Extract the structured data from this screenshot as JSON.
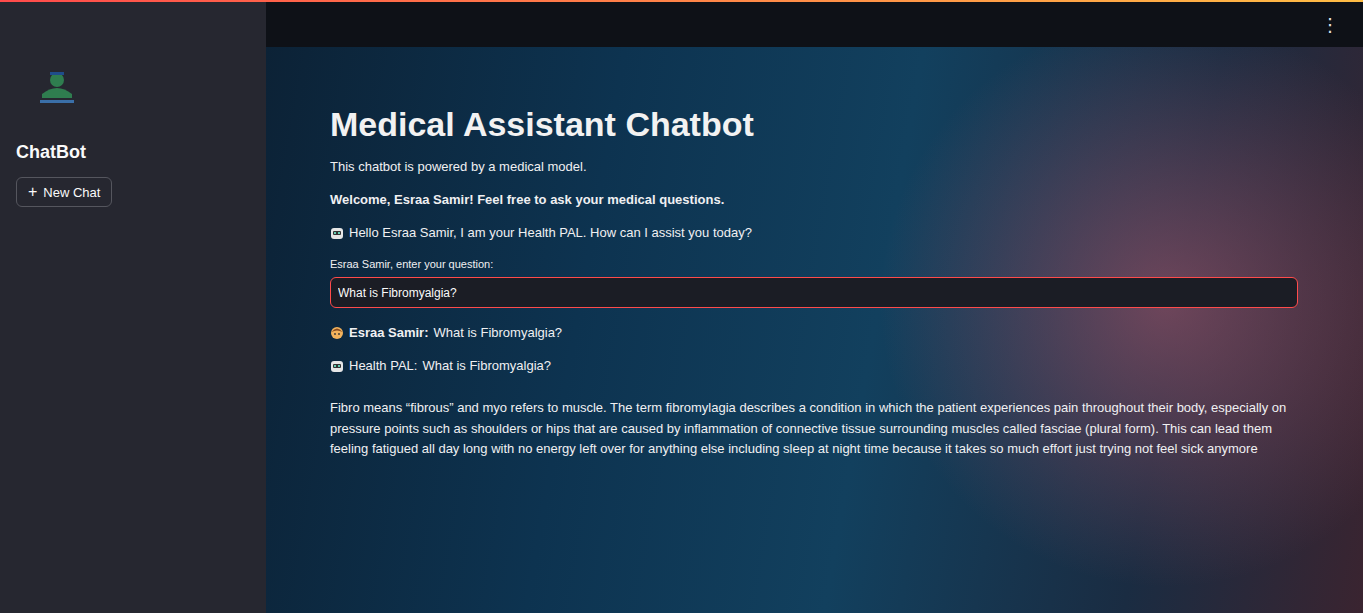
{
  "sidebar": {
    "title": "ChatBot",
    "new_chat_button": {
      "icon": "+",
      "label": "New Chat"
    }
  },
  "header": {
    "menu_icon": "⋮"
  },
  "main": {
    "title": "Medical Assistant Chatbot",
    "subtitle": "This chatbot is powered by a medical model.",
    "welcome": "Welcome, Esraa Samir! Feel free to ask your medical questions.",
    "greeting": "Hello Esraa Samir, I am your Health PAL. How can I assist you today?",
    "input": {
      "label": "Esraa Samir, enter your question:",
      "value": "What is Fibromyalgia?",
      "focused": true
    },
    "messages": [
      {
        "kind": "user",
        "speaker": "Esraa Samir:",
        "text": "What is Fibromyalgia?"
      },
      {
        "kind": "bot",
        "speaker": "Health PAL:",
        "text": "What is Fibromyalgia?"
      }
    ],
    "answer": "Fibro means “fibrous” and myo refers to muscle. The term fibromylagia describes a condition in which the patient experiences pain throughout their body, especially on pressure points such as shoulders or hips that are caused by inflammation of connective tissue surrounding muscles called fasciae (plural form). This can lead them feeling fatigued all day long with no energy left over for anything else including sleep at night time because it takes so much effort just trying not feel sick anymore"
  }
}
